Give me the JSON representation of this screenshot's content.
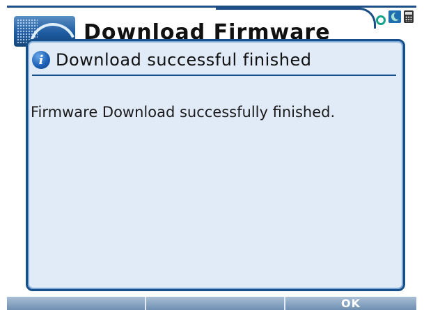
{
  "app": {
    "title": "Download Firmware"
  },
  "status_icons": [
    "search-icon",
    "night-mode-icon",
    "calculator-icon"
  ],
  "dialog": {
    "icon": "info-icon",
    "title": "Download successful finished",
    "message": "Firmware Download successfully finished."
  },
  "softkeys": [
    {
      "label": ""
    },
    {
      "label": ""
    },
    {
      "label": "OK"
    }
  ],
  "colors": {
    "frame": "#1d4f86",
    "dialog_bg": "#e1eaf7",
    "dialog_border": "#16508a",
    "softkey_bar": "#6f8fb1"
  }
}
